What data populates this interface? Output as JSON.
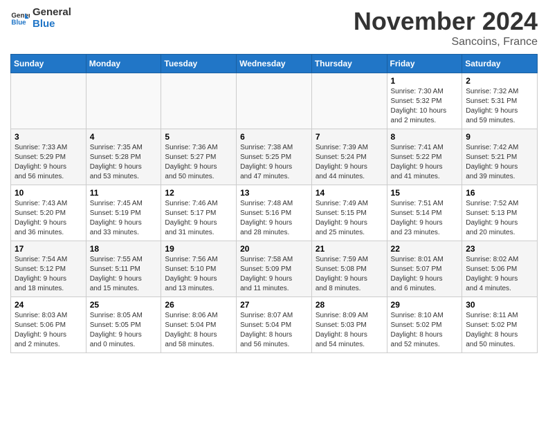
{
  "header": {
    "logo_text_general": "General",
    "logo_text_blue": "Blue",
    "month": "November 2024",
    "location": "Sancoins, France"
  },
  "weekdays": [
    "Sunday",
    "Monday",
    "Tuesday",
    "Wednesday",
    "Thursday",
    "Friday",
    "Saturday"
  ],
  "weeks": [
    [
      {
        "day": "",
        "info": ""
      },
      {
        "day": "",
        "info": ""
      },
      {
        "day": "",
        "info": ""
      },
      {
        "day": "",
        "info": ""
      },
      {
        "day": "",
        "info": ""
      },
      {
        "day": "1",
        "info": "Sunrise: 7:30 AM\nSunset: 5:32 PM\nDaylight: 10 hours\nand 2 minutes."
      },
      {
        "day": "2",
        "info": "Sunrise: 7:32 AM\nSunset: 5:31 PM\nDaylight: 9 hours\nand 59 minutes."
      }
    ],
    [
      {
        "day": "3",
        "info": "Sunrise: 7:33 AM\nSunset: 5:29 PM\nDaylight: 9 hours\nand 56 minutes."
      },
      {
        "day": "4",
        "info": "Sunrise: 7:35 AM\nSunset: 5:28 PM\nDaylight: 9 hours\nand 53 minutes."
      },
      {
        "day": "5",
        "info": "Sunrise: 7:36 AM\nSunset: 5:27 PM\nDaylight: 9 hours\nand 50 minutes."
      },
      {
        "day": "6",
        "info": "Sunrise: 7:38 AM\nSunset: 5:25 PM\nDaylight: 9 hours\nand 47 minutes."
      },
      {
        "day": "7",
        "info": "Sunrise: 7:39 AM\nSunset: 5:24 PM\nDaylight: 9 hours\nand 44 minutes."
      },
      {
        "day": "8",
        "info": "Sunrise: 7:41 AM\nSunset: 5:22 PM\nDaylight: 9 hours\nand 41 minutes."
      },
      {
        "day": "9",
        "info": "Sunrise: 7:42 AM\nSunset: 5:21 PM\nDaylight: 9 hours\nand 39 minutes."
      }
    ],
    [
      {
        "day": "10",
        "info": "Sunrise: 7:43 AM\nSunset: 5:20 PM\nDaylight: 9 hours\nand 36 minutes."
      },
      {
        "day": "11",
        "info": "Sunrise: 7:45 AM\nSunset: 5:19 PM\nDaylight: 9 hours\nand 33 minutes."
      },
      {
        "day": "12",
        "info": "Sunrise: 7:46 AM\nSunset: 5:17 PM\nDaylight: 9 hours\nand 31 minutes."
      },
      {
        "day": "13",
        "info": "Sunrise: 7:48 AM\nSunset: 5:16 PM\nDaylight: 9 hours\nand 28 minutes."
      },
      {
        "day": "14",
        "info": "Sunrise: 7:49 AM\nSunset: 5:15 PM\nDaylight: 9 hours\nand 25 minutes."
      },
      {
        "day": "15",
        "info": "Sunrise: 7:51 AM\nSunset: 5:14 PM\nDaylight: 9 hours\nand 23 minutes."
      },
      {
        "day": "16",
        "info": "Sunrise: 7:52 AM\nSunset: 5:13 PM\nDaylight: 9 hours\nand 20 minutes."
      }
    ],
    [
      {
        "day": "17",
        "info": "Sunrise: 7:54 AM\nSunset: 5:12 PM\nDaylight: 9 hours\nand 18 minutes."
      },
      {
        "day": "18",
        "info": "Sunrise: 7:55 AM\nSunset: 5:11 PM\nDaylight: 9 hours\nand 15 minutes."
      },
      {
        "day": "19",
        "info": "Sunrise: 7:56 AM\nSunset: 5:10 PM\nDaylight: 9 hours\nand 13 minutes."
      },
      {
        "day": "20",
        "info": "Sunrise: 7:58 AM\nSunset: 5:09 PM\nDaylight: 9 hours\nand 11 minutes."
      },
      {
        "day": "21",
        "info": "Sunrise: 7:59 AM\nSunset: 5:08 PM\nDaylight: 9 hours\nand 8 minutes."
      },
      {
        "day": "22",
        "info": "Sunrise: 8:01 AM\nSunset: 5:07 PM\nDaylight: 9 hours\nand 6 minutes."
      },
      {
        "day": "23",
        "info": "Sunrise: 8:02 AM\nSunset: 5:06 PM\nDaylight: 9 hours\nand 4 minutes."
      }
    ],
    [
      {
        "day": "24",
        "info": "Sunrise: 8:03 AM\nSunset: 5:06 PM\nDaylight: 9 hours\nand 2 minutes."
      },
      {
        "day": "25",
        "info": "Sunrise: 8:05 AM\nSunset: 5:05 PM\nDaylight: 9 hours\nand 0 minutes."
      },
      {
        "day": "26",
        "info": "Sunrise: 8:06 AM\nSunset: 5:04 PM\nDaylight: 8 hours\nand 58 minutes."
      },
      {
        "day": "27",
        "info": "Sunrise: 8:07 AM\nSunset: 5:04 PM\nDaylight: 8 hours\nand 56 minutes."
      },
      {
        "day": "28",
        "info": "Sunrise: 8:09 AM\nSunset: 5:03 PM\nDaylight: 8 hours\nand 54 minutes."
      },
      {
        "day": "29",
        "info": "Sunrise: 8:10 AM\nSunset: 5:02 PM\nDaylight: 8 hours\nand 52 minutes."
      },
      {
        "day": "30",
        "info": "Sunrise: 8:11 AM\nSunset: 5:02 PM\nDaylight: 8 hours\nand 50 minutes."
      }
    ]
  ]
}
